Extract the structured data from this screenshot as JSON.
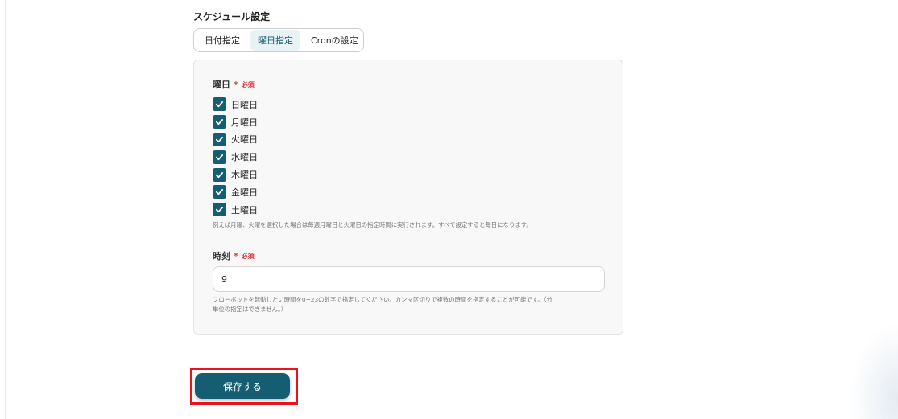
{
  "schedule": {
    "title": "スケジュール設定",
    "tabs": [
      {
        "label": "日付指定",
        "active": false
      },
      {
        "label": "曜日指定",
        "active": true
      },
      {
        "label": "Cronの設定",
        "active": false
      }
    ]
  },
  "weekday_field": {
    "label": "曜日",
    "required_mark": "*",
    "required_text": "必須",
    "days": [
      {
        "label": "日曜日",
        "checked": true
      },
      {
        "label": "月曜日",
        "checked": true
      },
      {
        "label": "火曜日",
        "checked": true
      },
      {
        "label": "水曜日",
        "checked": true
      },
      {
        "label": "木曜日",
        "checked": true
      },
      {
        "label": "金曜日",
        "checked": true
      },
      {
        "label": "土曜日",
        "checked": true
      }
    ],
    "help": "例えば月曜、火曜を選択した場合は毎週月曜日と火曜日の指定時間に実行されます。すべて設定すると毎日になります。"
  },
  "time_field": {
    "label": "時刻",
    "required_mark": "*",
    "required_text": "必須",
    "value": "9",
    "help_line1": "フローボットを起動したい時間を0~23の数字で指定してください。カンマ区切りで複数の時間を指定することが可能です。（分",
    "help_line2": "単位の指定はできません。）"
  },
  "save_button": {
    "label": "保存する"
  },
  "colors": {
    "accent": "#155d70",
    "required": "#e0393e",
    "highlight_box": "#e8141d",
    "tab_active_bg": "#e9f3f5"
  },
  "icons": {
    "checkbox": "checkmark-icon"
  }
}
